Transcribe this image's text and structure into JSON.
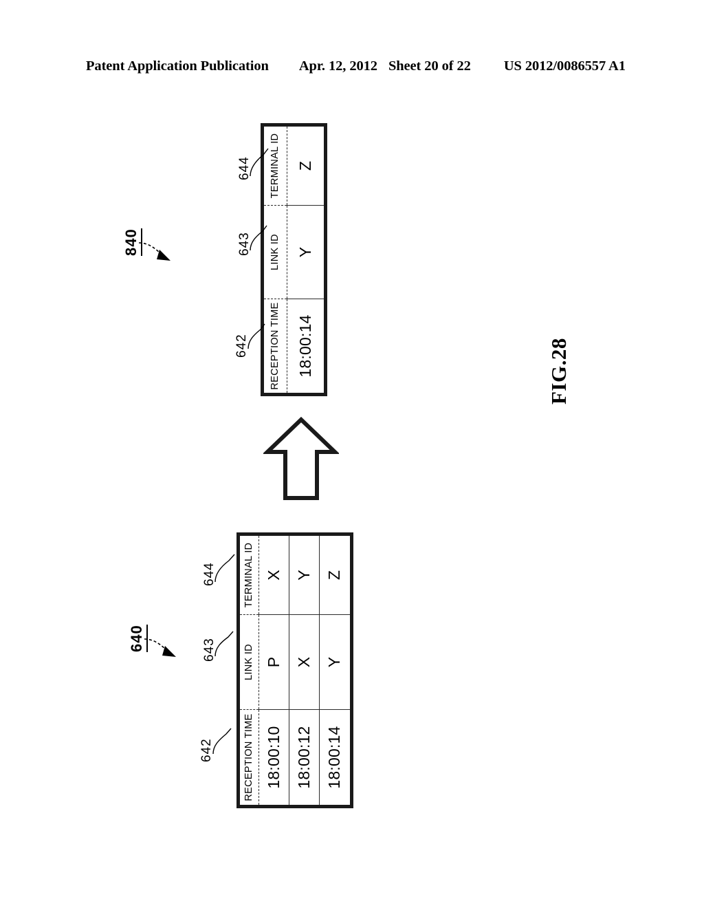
{
  "header": {
    "publication": "Patent Application Publication",
    "date": "Apr. 12, 2012",
    "sheet": "Sheet 20 of 22",
    "patent_number": "US 2012/0086557 A1"
  },
  "figure": {
    "label": "FIG.28"
  },
  "columns": {
    "reception_time": "RECEPTION TIME",
    "link_id": "LINK ID",
    "terminal_id": "TERMINAL ID"
  },
  "refs": {
    "table_after": "840",
    "table_before": "640",
    "col_reception_time": "642",
    "col_link_id": "643",
    "col_terminal_id": "644"
  },
  "table_before": {
    "ref": "640",
    "headers": [
      "RECEPTION TIME",
      "LINK ID",
      "TERMINAL ID"
    ],
    "rows": [
      [
        "18:00:10",
        "P",
        "X"
      ],
      [
        "18:00:12",
        "X",
        "Y"
      ],
      [
        "18:00:14",
        "Y",
        "Z"
      ]
    ]
  },
  "table_after": {
    "ref": "840",
    "headers": [
      "RECEPTION TIME",
      "LINK ID",
      "TERMINAL ID"
    ],
    "rows": [
      [
        "18:00:14",
        "Y",
        "Z"
      ]
    ]
  },
  "arrow": {
    "name": "upward-block-arrow",
    "direction": "up"
  },
  "colors": {
    "ink": "#000000",
    "border": "#1a1a1a",
    "grid": "#2b2b2b",
    "background": "#ffffff"
  }
}
